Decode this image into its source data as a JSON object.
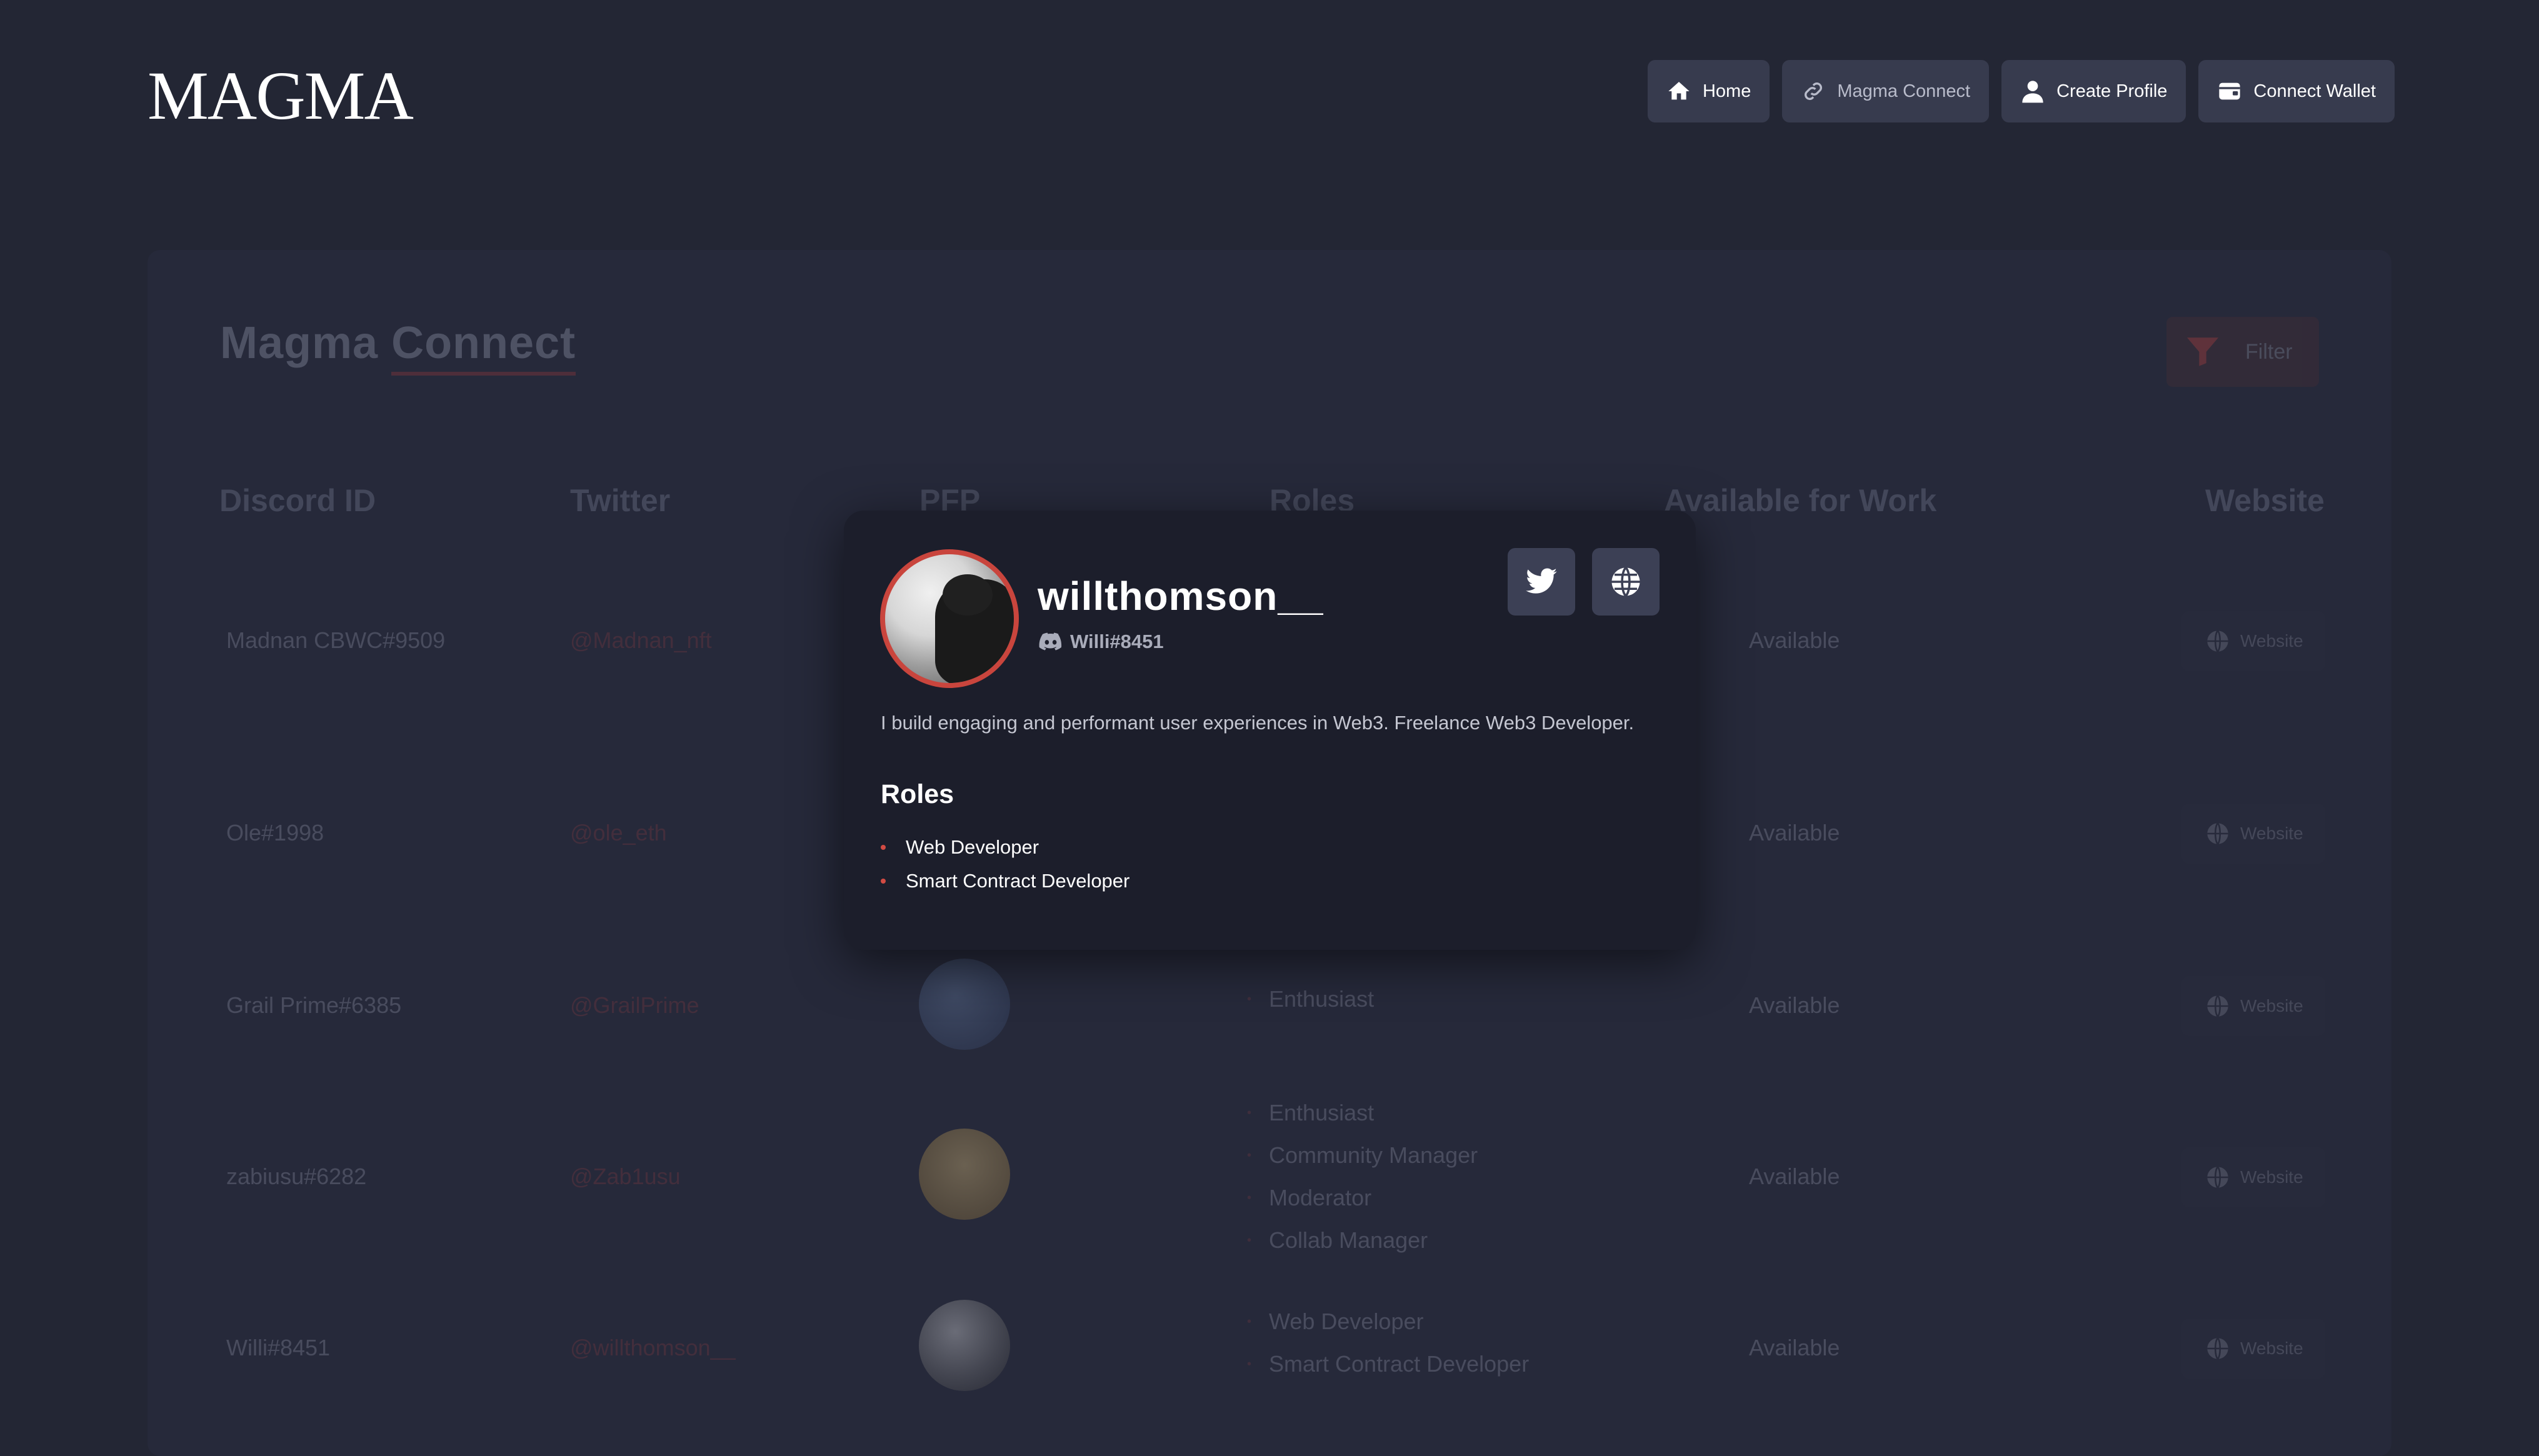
{
  "header": {
    "logo": "MAGMA",
    "nav": [
      {
        "label": "Home",
        "icon": "home-icon"
      },
      {
        "label": "Magma Connect",
        "icon": "link-icon"
      },
      {
        "label": "Create Profile",
        "icon": "user-icon"
      },
      {
        "label": "Connect Wallet",
        "icon": "wallet-icon"
      }
    ]
  },
  "page": {
    "title_part1": "Magma ",
    "title_part2": "Connect",
    "filter_label": "Filter",
    "columns": [
      "Discord ID",
      "Twitter",
      "PFP",
      "Roles",
      "Available for Work",
      "Website"
    ],
    "rows": [
      {
        "discord": "Madnan CBWC#9509",
        "twitter": "@Madnan_nft",
        "roles": [],
        "available": "Available",
        "website": "Website"
      },
      {
        "discord": "Ole#1998",
        "twitter": "@ole_eth",
        "roles": [],
        "available": "Available",
        "website": "Website"
      },
      {
        "discord": "Grail Prime#6385",
        "twitter": "@GrailPrime",
        "roles": [
          "Enthusiast"
        ],
        "available": "Available",
        "website": "Website"
      },
      {
        "discord": "zabiusu#6282",
        "twitter": "@Zab1usu",
        "roles": [
          "Enthusiast",
          "Community Manager",
          "Moderator",
          "Collab Manager"
        ],
        "available": "Available",
        "website": "Website"
      },
      {
        "discord": "Willi#8451",
        "twitter": "@willthomson__",
        "roles": [
          "Web Developer",
          "Smart Contract Developer"
        ],
        "available": "Available",
        "website": "Website"
      }
    ]
  },
  "modal": {
    "username": "willthomson__",
    "discord": "Willi#8451",
    "bio": "I build engaging and performant user experiences in Web3. Freelance Web3 Developer.",
    "roles_title": "Roles",
    "roles": [
      "Web Developer",
      "Smart Contract Developer"
    ],
    "accent": "#c9453d"
  }
}
